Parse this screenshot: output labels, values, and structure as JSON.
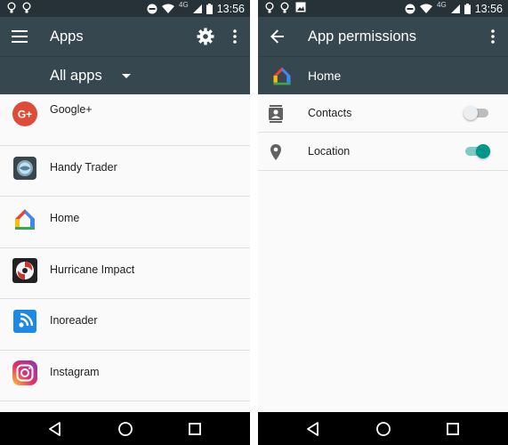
{
  "status_bar": {
    "time": "13:56",
    "network": "4G"
  },
  "apps_screen": {
    "title": "Apps",
    "filter": "All apps",
    "apps": [
      {
        "name": "Google+",
        "icon": "google-plus-icon"
      },
      {
        "name": "Handy Trader",
        "icon": "handy-trader-icon"
      },
      {
        "name": "Home",
        "icon": "home-app-icon"
      },
      {
        "name": "Hurricane Impact",
        "icon": "hurricane-impact-icon"
      },
      {
        "name": "Inoreader",
        "icon": "inoreader-icon"
      },
      {
        "name": "Instagram",
        "icon": "instagram-icon"
      }
    ]
  },
  "permissions_screen": {
    "title": "App permissions",
    "app_name": "Home",
    "permissions": [
      {
        "label": "Contacts",
        "icon": "contacts-icon",
        "enabled": false
      },
      {
        "label": "Location",
        "icon": "location-pin-icon",
        "enabled": true
      }
    ]
  },
  "colors": {
    "appbar": "#37474f",
    "statusbar": "#263238",
    "toggle_on": "#009688",
    "toggle_off": "#bdbdbd",
    "navbar": "#000000"
  }
}
